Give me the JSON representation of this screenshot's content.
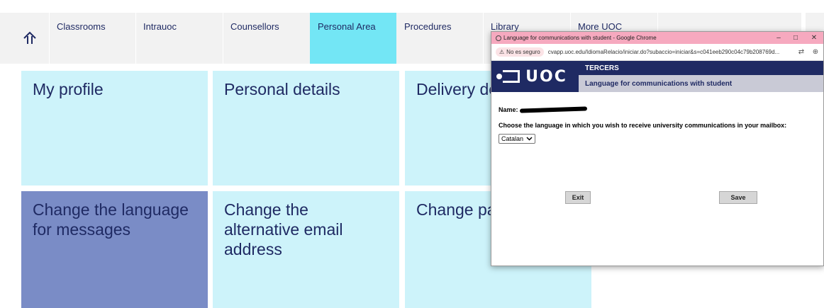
{
  "nav": {
    "items": [
      {
        "label": "Classrooms"
      },
      {
        "label": "Intrauoc"
      },
      {
        "label": "Counsellors"
      },
      {
        "label": "Personal Area",
        "active": true
      },
      {
        "label": "Procedures"
      },
      {
        "label": "Library"
      },
      {
        "label": "More UOC"
      }
    ]
  },
  "tiles": [
    {
      "label": "My profile"
    },
    {
      "label": "Personal details"
    },
    {
      "label": "Delivery de"
    },
    {
      "label": "Change the language for messages",
      "active": true
    },
    {
      "label": "Change the alternative email address"
    },
    {
      "label": "Change pas"
    }
  ],
  "popup": {
    "window_title": "Language for communications with student - Google Chrome",
    "security_label": "No es seguro",
    "url": "cvapp.uoc.edu/IdiomaRelacio/iniciar.do?subaccio=iniciar&s=c041eeb290c04c79b208769d...",
    "logo_text": "UOC",
    "header_title": "TERCERS",
    "header_subtitle": "Language for communications with student",
    "name_label": "Name:",
    "question": "Choose the language in which you wish to receive university communications in your mailbox:",
    "language_selected": "Catalan",
    "exit_label": "Exit",
    "save_label": "Save"
  },
  "colors": {
    "nav_active": "#73e6f5",
    "tile_bg": "#cdf3fa",
    "tile_active": "#7a8cc6",
    "brand_navy": "#1f2a63",
    "popup_titlebar": "#f6a9bf"
  }
}
